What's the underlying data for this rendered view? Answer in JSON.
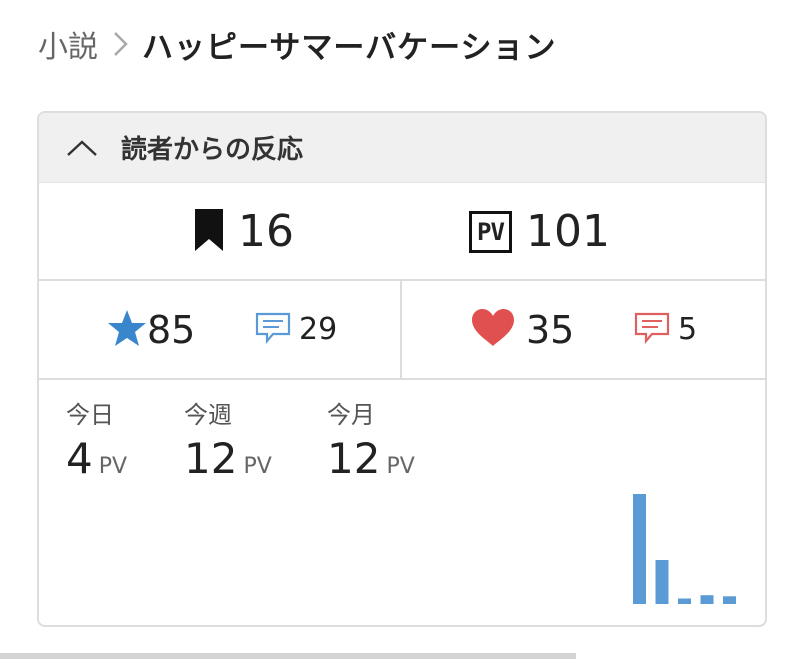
{
  "breadcrumb": {
    "parent": "小説",
    "current": "ハッピーサマーバケーション"
  },
  "reactions": {
    "title": "読者からの反応",
    "bookmarks": "16",
    "pv_badge": "PV",
    "pv_total": "101",
    "stars": "85",
    "star_comments": "29",
    "hearts": "35",
    "heart_comments": "5"
  },
  "pv_periods": [
    {
      "label": "今日",
      "value": "4",
      "unit": "PV"
    },
    {
      "label": "今週",
      "value": "12",
      "unit": "PV"
    },
    {
      "label": "今月",
      "value": "12",
      "unit": "PV"
    }
  ],
  "colors": {
    "star": "#3a86cc",
    "heart": "#e05050",
    "bar": "#5b9bd5",
    "comment_blue": "#5b9bd5",
    "comment_red": "#e06060"
  },
  "icons": [
    "chevron-right-icon",
    "chevron-up-icon",
    "bookmark-icon",
    "pv-icon",
    "star-icon",
    "comment-icon",
    "heart-icon"
  ],
  "chart_data": {
    "type": "bar",
    "values": [
      10,
      4,
      0.5,
      0.8,
      0.7
    ],
    "ylim": [
      0,
      10
    ]
  }
}
